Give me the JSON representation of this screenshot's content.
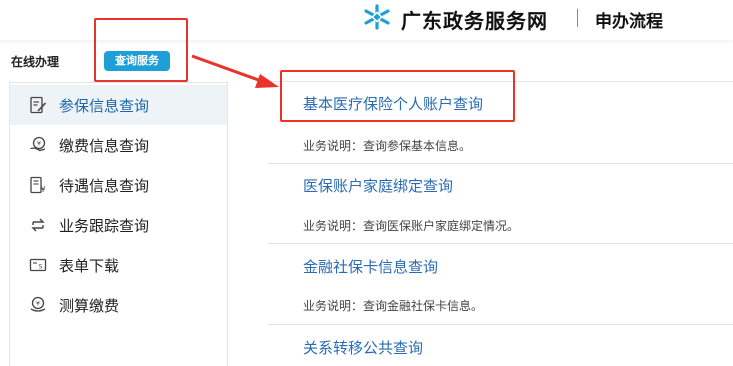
{
  "header": {
    "brand": "广东政务服务网",
    "page_heading": "申办流程",
    "logo_icon": "snowflake-logo-icon",
    "logo_color": "#1e9fd7"
  },
  "left_panel": {
    "title": "在线办理",
    "active_tab": "查询服务"
  },
  "sidebar": {
    "items": [
      {
        "label": "参保信息查询",
        "icon": "document-edit-icon",
        "active": true
      },
      {
        "label": "缴费信息查询",
        "icon": "coin-hand-icon",
        "active": false
      },
      {
        "label": "待遇信息查询",
        "icon": "yen-document-icon",
        "active": false
      },
      {
        "label": "业务跟踪查询",
        "icon": "transfer-icon",
        "active": false
      },
      {
        "label": "表单下载",
        "icon": "form-download-icon",
        "active": false
      },
      {
        "label": "测算缴费",
        "icon": "calculate-payment-icon",
        "active": false
      }
    ]
  },
  "services": [
    {
      "title": "基本医疗保险个人账户查询",
      "desc": "业务说明：查询参保基本信息。"
    },
    {
      "title": "医保账户家庭绑定查询",
      "desc": "业务说明：查询医保账户家庭绑定情况。"
    },
    {
      "title": "金融社保卡信息查询",
      "desc": "业务说明：查询金融社保卡信息。"
    },
    {
      "title": "关系转移公共查询",
      "desc": ""
    }
  ],
  "colors": {
    "accent": "#1e9fd7",
    "link": "#2a6bb3",
    "annotation": "#e8322a"
  }
}
